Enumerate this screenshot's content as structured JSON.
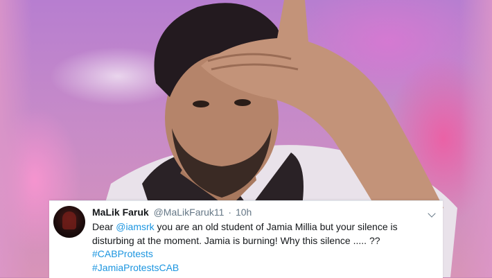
{
  "tweet": {
    "display_name": "MaLik Faruk",
    "handle": "@MaLikFaruk11",
    "separator": "·",
    "time": "10h",
    "text_before": "Dear ",
    "mention": "@iamsrk",
    "text_after": " you are an old student of Jamia Millia but your silence is disturbing at the moment.  Jamia is burning!  Why this silence ..... ??",
    "hashtags": [
      "#CABProtests",
      "#JamiaProtestsCAB"
    ]
  },
  "colors": {
    "link": "#1b95e0",
    "name": "#14171a",
    "meta": "#657786",
    "background_accent": "#c98bb8"
  },
  "icons": [
    "chevron-down-icon",
    "avatar-image"
  ]
}
